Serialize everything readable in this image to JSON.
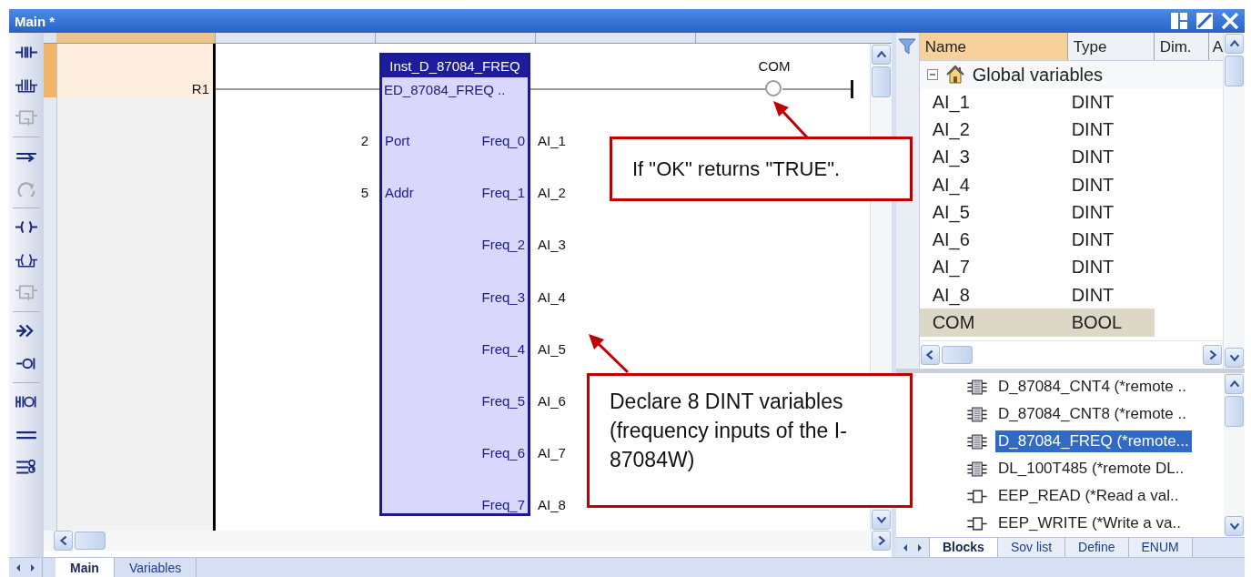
{
  "window": {
    "title": "Main *"
  },
  "toolbar": [
    {
      "kind": "contact",
      "disabled": false
    },
    {
      "kind": "parallel_contact",
      "disabled": false
    },
    {
      "kind": "block",
      "disabled": true
    },
    {
      "kind": "wire",
      "disabled": false
    },
    {
      "kind": "refresh",
      "disabled": true
    },
    {
      "kind": "coil",
      "disabled": false
    },
    {
      "kind": "parallel_coil",
      "disabled": false
    },
    {
      "kind": "block",
      "disabled": true
    },
    {
      "kind": "jump",
      "disabled": false
    },
    {
      "kind": "return",
      "disabled": false
    },
    {
      "kind": "contact_coil",
      "disabled": false
    },
    {
      "kind": "double_line",
      "disabled": false
    },
    {
      "kind": "branch",
      "disabled": false
    }
  ],
  "editor": {
    "rung_label": "R1",
    "block": {
      "instance": "Inst_D_87084_FREQ",
      "type": "ED_87084_FREQ ..",
      "inputs": [
        {
          "value": "2",
          "pin": "Port"
        },
        {
          "value": "5",
          "pin": "Addr"
        }
      ],
      "outputs": [
        {
          "pin": "Freq_0",
          "variable": "AI_1"
        },
        {
          "pin": "Freq_1",
          "variable": "AI_2"
        },
        {
          "pin": "Freq_2",
          "variable": "AI_3"
        },
        {
          "pin": "Freq_3",
          "variable": "AI_4"
        },
        {
          "pin": "Freq_4",
          "variable": "AI_5"
        },
        {
          "pin": "Freq_5",
          "variable": "AI_6"
        },
        {
          "pin": "Freq_6",
          "variable": "AI_7"
        },
        {
          "pin": "Freq_7",
          "variable": "AI_8"
        }
      ]
    },
    "coil": {
      "label": "COM"
    }
  },
  "tabs": [
    {
      "label": "Main",
      "selected": true
    },
    {
      "label": "Variables",
      "selected": false
    }
  ],
  "variables": {
    "columns": [
      "Name",
      "Type",
      "Dim.",
      "A"
    ],
    "group": {
      "label": "Global variables",
      "expanded": true
    },
    "rows": [
      {
        "name": "AI_1",
        "type": "DINT",
        "selected": false
      },
      {
        "name": "AI_2",
        "type": "DINT",
        "selected": false
      },
      {
        "name": "AI_3",
        "type": "DINT",
        "selected": false
      },
      {
        "name": "AI_4",
        "type": "DINT",
        "selected": false
      },
      {
        "name": "AI_5",
        "type": "DINT",
        "selected": false
      },
      {
        "name": "AI_6",
        "type": "DINT",
        "selected": false
      },
      {
        "name": "AI_7",
        "type": "DINT",
        "selected": false
      },
      {
        "name": "AI_8",
        "type": "DINT",
        "selected": false
      },
      {
        "name": "COM",
        "type": "BOOL",
        "selected": true
      }
    ]
  },
  "blocks": {
    "items": [
      {
        "kind": "function_block",
        "label": "D_87084_CNT4 (*remote ..",
        "selected": false
      },
      {
        "kind": "function_block",
        "label": "D_87084_CNT8 (*remote ..",
        "selected": false
      },
      {
        "kind": "function_block",
        "label": "D_87084_FREQ (*remote...",
        "selected": true
      },
      {
        "kind": "function_block",
        "label": "DL_100T485 (*remote DL..",
        "selected": false
      },
      {
        "kind": "function",
        "label": "EEP_READ (*Read a val..",
        "selected": false
      },
      {
        "kind": "function",
        "label": "EEP_WRITE (*Write a va..",
        "selected": false
      }
    ],
    "tabs": [
      {
        "label": "Blocks",
        "selected": true
      },
      {
        "label": "Sov list",
        "selected": false
      },
      {
        "label": "Define",
        "selected": false
      },
      {
        "label": "ENUM",
        "selected": false
      }
    ]
  },
  "callouts": [
    {
      "text": "If \"OK\" returns \"TRUE\"."
    },
    {
      "text": "Declare 8 DINT variables (frequency inputs of the I-87084W)"
    }
  ]
}
